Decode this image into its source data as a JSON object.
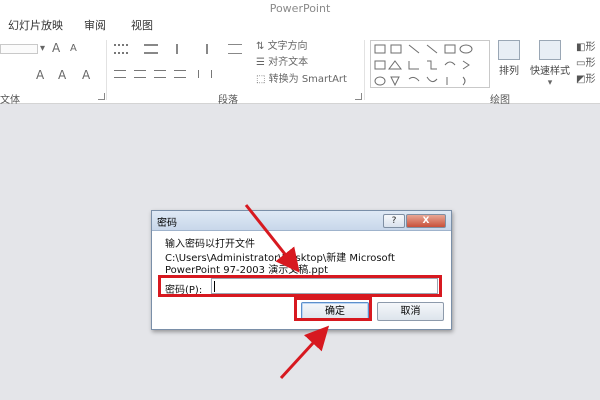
{
  "app": {
    "title": "PowerPoint"
  },
  "tabs": [
    {
      "label": "幻灯片放映"
    },
    {
      "label": "审阅"
    },
    {
      "label": "视图"
    }
  ],
  "ribbon": {
    "groups": [
      {
        "label": "文体"
      },
      {
        "label": "段落"
      },
      {
        "label": "绘图"
      }
    ],
    "text_direction": "文字方向",
    "align_text": "对齐文本",
    "convert_smartart": "转换为 SmartArt",
    "arrange": "排列",
    "quick_styles": "快速样式",
    "shape_fill_cut": "形",
    "font_grow": "A",
    "font_shrink": "A",
    "font_color": "A",
    "font_size_dropdown": "▾",
    "quick_styles_dropdown": "▾"
  },
  "dialog": {
    "title": "密码",
    "help_label": "?",
    "close_label": "X",
    "prompt": "输入密码以打开文件",
    "path_line1": "C:\\Users\\Administrator\\Desktop\\新建 Microsoft",
    "path_line2": "PowerPoint 97-2003 演示文稿.ppt",
    "password_label": "密码(P):",
    "password_value": "",
    "ok_label": "确定",
    "cancel_label": "取消"
  },
  "colors": {
    "highlight": "#d71920",
    "canvas": "#e4e5e9",
    "titlebar_text": "#8a8a8a"
  }
}
